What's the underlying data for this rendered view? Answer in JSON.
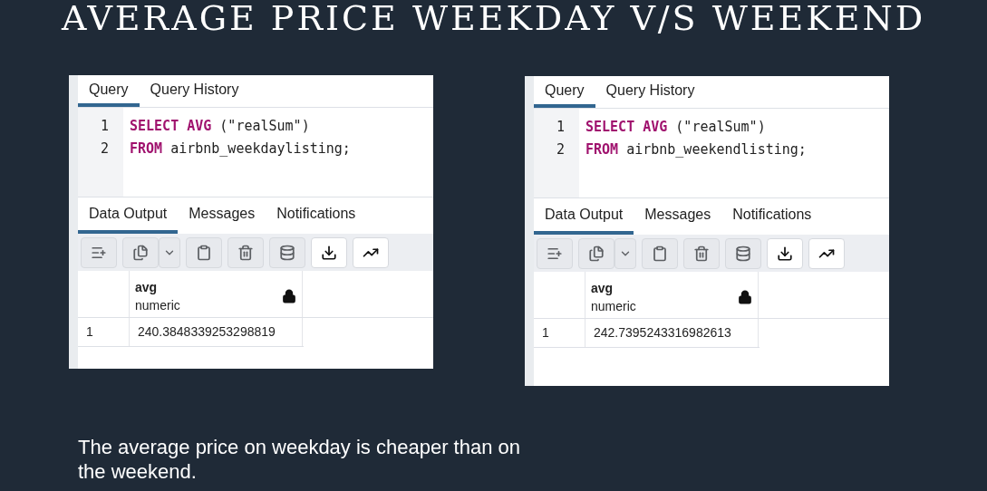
{
  "title": "AVERAGE PRICE WEEKDAY V/S WEEKEND",
  "panels": [
    {
      "query_tabs": [
        {
          "label": "Query",
          "selected": true
        },
        {
          "label": "Query History",
          "selected": false
        }
      ],
      "code_lines": [
        {
          "number": "1",
          "tokens": [
            {
              "kind": "keyword",
              "text": "SELECT AVG"
            },
            {
              "kind": "plain",
              "text": " (\"realSum\")"
            }
          ]
        },
        {
          "number": "2",
          "tokens": [
            {
              "kind": "keyword",
              "text": "FROM"
            },
            {
              "kind": "plain",
              "text": " airbnb_weekdaylisting;"
            }
          ]
        }
      ],
      "output_tabs": [
        {
          "label": "Data Output",
          "selected": true
        },
        {
          "label": "Messages",
          "selected": false
        },
        {
          "label": "Notifications",
          "selected": false
        }
      ],
      "toolbar": [
        {
          "kind": "add-row",
          "disabled": true
        },
        {
          "kind": "copy",
          "disabled": true
        },
        {
          "kind": "dropdown",
          "disabled": true
        },
        {
          "kind": "paste",
          "disabled": true
        },
        {
          "kind": "delete",
          "disabled": true
        },
        {
          "kind": "save-data",
          "disabled": true
        },
        {
          "kind": "download",
          "disabled": false
        },
        {
          "kind": "graph",
          "disabled": false
        }
      ],
      "table": {
        "columns": [
          {
            "name": "avg",
            "type": "numeric",
            "locked": true
          }
        ],
        "rows": [
          {
            "number": "1",
            "cells": [
              "240.3848339253298819"
            ]
          }
        ]
      }
    },
    {
      "query_tabs": [
        {
          "label": "Query",
          "selected": true
        },
        {
          "label": "Query History",
          "selected": false
        }
      ],
      "code_lines": [
        {
          "number": "1",
          "tokens": [
            {
              "kind": "keyword",
              "text": "SELECT AVG"
            },
            {
              "kind": "plain",
              "text": " (\"realSum\")"
            }
          ]
        },
        {
          "number": "2",
          "tokens": [
            {
              "kind": "keyword",
              "text": "FROM"
            },
            {
              "kind": "plain",
              "text": " airbnb_weekendlisting;"
            }
          ]
        }
      ],
      "output_tabs": [
        {
          "label": "Data Output",
          "selected": true
        },
        {
          "label": "Messages",
          "selected": false
        },
        {
          "label": "Notifications",
          "selected": false
        }
      ],
      "toolbar": [
        {
          "kind": "add-row",
          "disabled": true
        },
        {
          "kind": "copy",
          "disabled": true
        },
        {
          "kind": "dropdown",
          "disabled": true
        },
        {
          "kind": "paste",
          "disabled": true
        },
        {
          "kind": "delete",
          "disabled": true
        },
        {
          "kind": "save-data",
          "disabled": true
        },
        {
          "kind": "download",
          "disabled": false
        },
        {
          "kind": "graph",
          "disabled": false
        }
      ],
      "table": {
        "columns": [
          {
            "name": "avg",
            "type": "numeric",
            "locked": true
          }
        ],
        "rows": [
          {
            "number": "1",
            "cells": [
              "242.7395243316982613"
            ]
          }
        ]
      }
    }
  ],
  "caption": "The average price on weekday is cheaper than on the weekend."
}
